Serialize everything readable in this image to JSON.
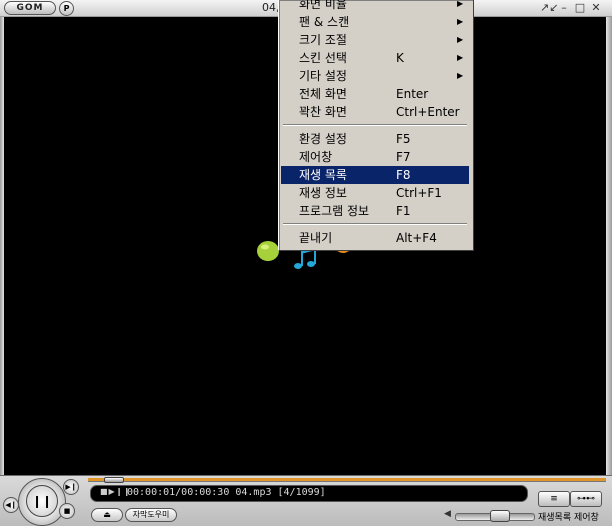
{
  "window": {
    "logo_text": "GOM",
    "p_label": "P",
    "title": "04,",
    "controls": [
      "↗↙",
      "–",
      "□",
      "✕"
    ]
  },
  "context_menu": {
    "items": [
      {
        "label": "화면 비율",
        "shortcut": "",
        "submenu": true
      },
      {
        "label": "팬 & 스캔",
        "shortcut": "",
        "submenu": true
      },
      {
        "label": "크기 조절",
        "shortcut": "",
        "submenu": true
      },
      {
        "label": "스킨 선택",
        "shortcut": "K",
        "submenu": true
      },
      {
        "label": "기타 설정",
        "shortcut": "",
        "submenu": true
      },
      {
        "label": "전체 화면",
        "shortcut": "Enter",
        "submenu": false
      },
      {
        "label": "꽉찬 화면",
        "shortcut": "Ctrl+Enter",
        "submenu": false
      },
      {
        "label": "환경 설정",
        "shortcut": "F5",
        "submenu": false
      },
      {
        "label": "제어창",
        "shortcut": "F7",
        "submenu": false
      },
      {
        "label": "재생 목록",
        "shortcut": "F8",
        "submenu": false,
        "highlighted": true
      },
      {
        "label": "재생 정보",
        "shortcut": "Ctrl+F1",
        "submenu": false
      },
      {
        "label": "프로그램 정보",
        "shortcut": "F1",
        "submenu": false
      },
      {
        "label": "끝내기",
        "shortcut": "Alt+F4",
        "submenu": false
      }
    ],
    "highlight_color": "#0a246a"
  },
  "player": {
    "status_line": "00:00:01/00:00:30 04.mp3 [4/1099]",
    "lcd_icons": "■▶❙❙",
    "progress": 0.03,
    "volume": 0.55,
    "eject_symbol": "⏏",
    "subtitle_button": "자막도우미",
    "playlist_label": "재생목록",
    "control_label": "제어창",
    "pause_symbol": "❙❙",
    "prev_symbol": "◀❙",
    "next_symbol": "▶❙",
    "stop_symbol": "■",
    "playlist_icon": "≡",
    "control_icon": "⊶⊷",
    "speaker_symbol": "◀"
  },
  "colors": {
    "video_bg": "#000000",
    "seek_fill": "#e0962a",
    "logo_green": "#a6d13a",
    "logo_cyan": "#22a7d6",
    "logo_orange": "#e88a1a"
  }
}
